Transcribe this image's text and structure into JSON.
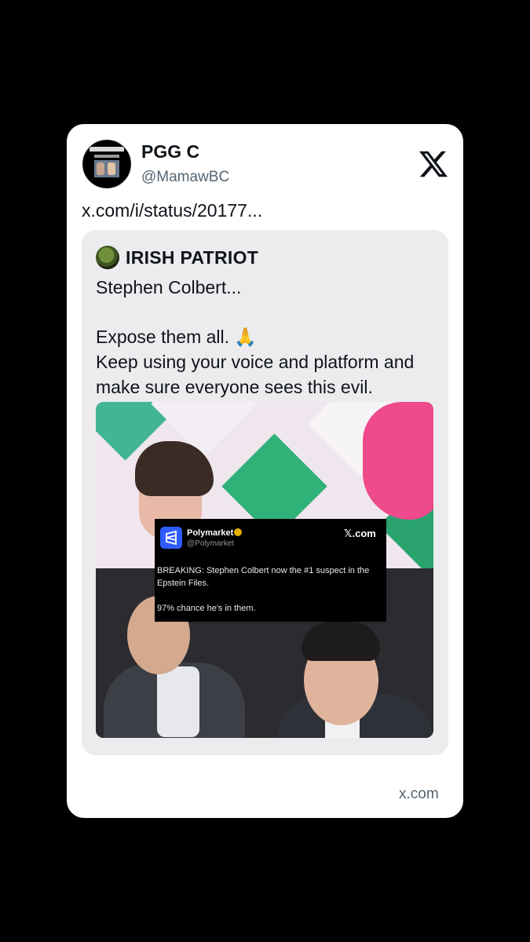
{
  "post": {
    "display_name": "PGG C",
    "handle": "@MamawBC",
    "link_text": "x.com/i/status/20177..."
  },
  "quote": {
    "display_name": "IRISH PATRIOT",
    "lines": [
      "Stephen Colbert...",
      "Expose them all. 🙏",
      "Keep using your voice and platform and make sure everyone sees this evil."
    ],
    "embedded_tweet": {
      "name": "Polymarket",
      "handle": "@Polymarket",
      "site": "𝕏.com",
      "text_1": "BREAKING: Stephen Colbert now the #1 suspect in the Epstein Files.",
      "text_2": "97% chance he's in them."
    }
  },
  "footer": {
    "site": "x.com"
  },
  "icons": {
    "platform": "x-logo-icon",
    "verified": "verified-badge-icon"
  },
  "colors": {
    "background": "#000000",
    "card": "#ffffff",
    "quote_bg": "#ececee",
    "muted_text": "#536471",
    "polymarket_blue": "#2e5cff"
  }
}
